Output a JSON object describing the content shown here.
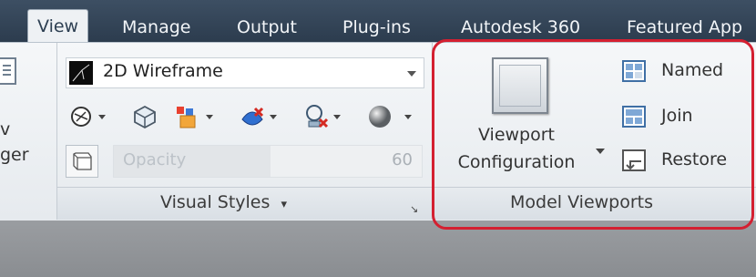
{
  "tabs": [
    {
      "label": "View",
      "active": true
    },
    {
      "label": "Manage"
    },
    {
      "label": "Output"
    },
    {
      "label": "Plug-ins"
    },
    {
      "label": "Autodesk 360"
    },
    {
      "label": "Featured App"
    }
  ],
  "left_panel": {
    "line1": "v",
    "line2": "ger"
  },
  "visual_styles": {
    "current_style": "2D Wireframe",
    "tools": [
      "xray-icon",
      "visual-style-cube-icon",
      "color-layers-icon",
      "shadow-icon",
      "edge-settings-icon",
      "material-sphere-icon"
    ],
    "opacity_label": "Opacity",
    "opacity_value": "60",
    "panel_title": "Visual Styles",
    "panel_title_arrow": "▾"
  },
  "model_viewports": {
    "config_line1": "Viewport",
    "config_line2": "Configuration",
    "named_label": "Named",
    "join_label": "Join",
    "restore_label": "Restore",
    "panel_title": "Model Viewports"
  },
  "colors": {
    "highlight": "#d42031",
    "tabbar": "#344659",
    "ribbon": "#eef1f4"
  }
}
